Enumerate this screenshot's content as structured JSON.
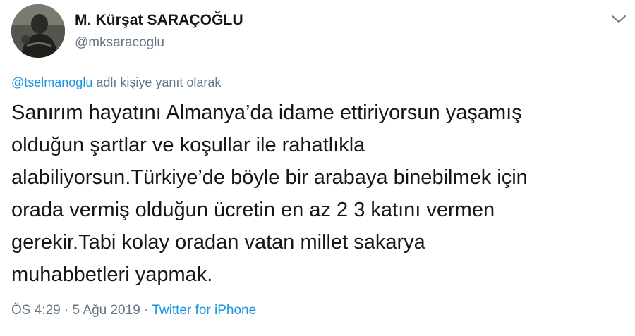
{
  "author": {
    "name": "M. Kürşat SARAÇOĞLU",
    "handle": "@mksaracoglu"
  },
  "reply_context": {
    "mention": "@tselmanoglu",
    "suffix": " adlı kişiye yanıt olarak"
  },
  "tweet": {
    "text": "Sanırım hayatını Almanya’da idame ettiriyorsun yaşamış\nolduğun şartlar ve koşullar ile rahatlıkla\nalabiliyorsun.Türkiye’de böyle bir arabaya binebilmek için\norada vermiş olduğun ücretin en az 2 3 katını vermen\ngerekir.Tabi kolay oradan vatan millet sakarya\nmuhabbetleri yapmak."
  },
  "meta": {
    "time": "ÖS 4:29",
    "separator1": " · ",
    "date": "5 Ağu 2019",
    "separator2": " · ",
    "source": "Twitter for iPhone"
  },
  "icons": {
    "menu": "chevron-down-icon",
    "avatar": "profile-photo"
  },
  "colors": {
    "text": "#14171a",
    "secondary": "#657786",
    "link": "#1b95e0",
    "background": "#ffffff"
  }
}
